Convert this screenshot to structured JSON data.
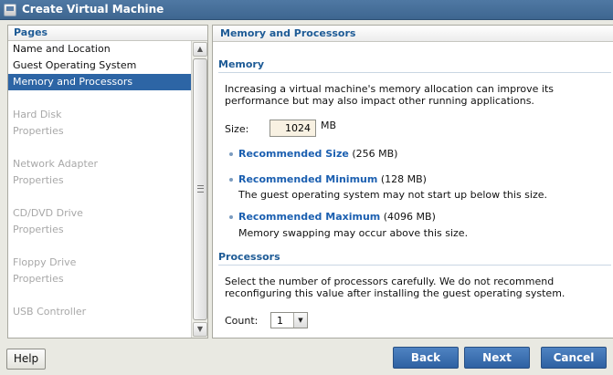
{
  "window": {
    "title": "Create Virtual Machine"
  },
  "pages": {
    "header": "Pages",
    "items": [
      {
        "label": "Name and Location",
        "state": "enabled"
      },
      {
        "label": "Guest Operating System",
        "state": "enabled"
      },
      {
        "label": "Memory and Processors",
        "state": "selected"
      },
      {
        "label": "Hard Disk",
        "state": "disabled"
      },
      {
        "label": "Properties",
        "state": "disabled"
      },
      {
        "label": "Network Adapter",
        "state": "disabled"
      },
      {
        "label": "Properties",
        "state": "disabled"
      },
      {
        "label": "CD/DVD Drive",
        "state": "disabled"
      },
      {
        "label": "Properties",
        "state": "disabled"
      },
      {
        "label": "Floppy Drive",
        "state": "disabled"
      },
      {
        "label": "Properties",
        "state": "disabled"
      },
      {
        "label": "USB Controller",
        "state": "disabled"
      }
    ]
  },
  "content": {
    "header": "Memory and Processors",
    "memory": {
      "title": "Memory",
      "description": "Increasing a virtual machine's memory allocation can improve its performance but may also impact other running applications.",
      "size_label": "Size:",
      "size_value": "1024",
      "size_unit": "MB",
      "recommended": {
        "link": "Recommended Size",
        "value": "(256 MB)"
      },
      "minimum": {
        "link": "Recommended Minimum",
        "value": "(128 MB)",
        "note": "The guest operating system may not start up below this size."
      },
      "maximum": {
        "link": "Recommended Maximum",
        "value": "(4096 MB)",
        "note": "Memory swapping may occur above this size."
      }
    },
    "processors": {
      "title": "Processors",
      "description": "Select the number of processors carefully. We do not recommend reconfiguring this value after installing the guest operating system.",
      "count_label": "Count:",
      "count_value": "1"
    }
  },
  "buttons": {
    "help": "Help",
    "back": "Back",
    "next": "Next",
    "cancel": "Cancel"
  },
  "colors": {
    "accent": "#1e5b96",
    "selection": "#2d65a5",
    "primary_button": "#3a6eb0"
  }
}
